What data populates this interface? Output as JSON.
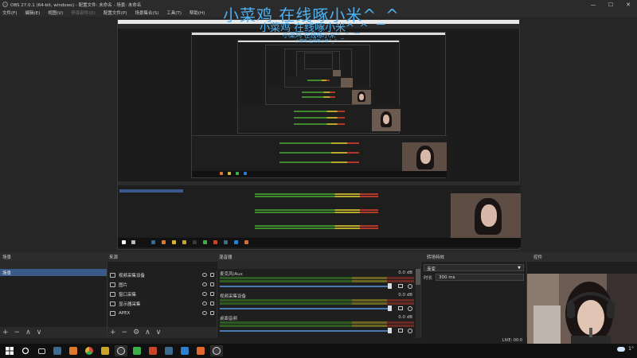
{
  "window": {
    "title": "OBS 27.0.1 (64-bit, windows) - 配置文件: 未命名 - 场景: 未命名",
    "minimize": "—",
    "maximize": "☐",
    "close": "✕"
  },
  "menu": [
    {
      "label": "文件(F)",
      "enabled": true
    },
    {
      "label": "编辑(E)",
      "enabled": true
    },
    {
      "label": "视图(V)",
      "enabled": true
    },
    {
      "label": "停靠部件(D)",
      "enabled": false
    },
    {
      "label": "配置文件(P)",
      "enabled": true
    },
    {
      "label": "场景集合(S)",
      "enabled": true
    },
    {
      "label": "工具(T)",
      "enabled": true
    },
    {
      "label": "帮助(H)",
      "enabled": true
    }
  ],
  "overlay": {
    "text": "小菜鸡 在线啄小米^_^",
    "color": "#4fb0f0"
  },
  "docks": {
    "scenes": {
      "title": "场景",
      "items": [
        "场景"
      ]
    },
    "sources": {
      "title": "来源",
      "items": [
        {
          "label": "视频采集设备",
          "icon": "camera-icon"
        },
        {
          "label": "图片",
          "icon": "image-icon"
        },
        {
          "label": "窗口采集",
          "icon": "window-icon"
        },
        {
          "label": "显示器采集",
          "icon": "monitor-icon"
        },
        {
          "label": "APEX",
          "icon": "game-icon"
        }
      ]
    },
    "mixer": {
      "title": "混音器",
      "channels": [
        {
          "name": "麦克风/Aux",
          "db": "0.0 dB"
        },
        {
          "name": "视频采集设备",
          "db": "0.0 dB"
        },
        {
          "name": "桌面音频",
          "db": "0.0 dB"
        }
      ]
    },
    "transitions": {
      "title": "转场特效",
      "selected": "渐变",
      "duration_label": "时长",
      "duration_value": "300 ms"
    },
    "controls": {
      "title": "控件"
    }
  },
  "status": {
    "live": "LIVE: 00:0"
  },
  "taskbar": {
    "items": [
      {
        "name": "start-icon",
        "color": "#ffffff"
      },
      {
        "name": "search-icon",
        "color": "#ffffff"
      },
      {
        "name": "task-view-icon",
        "color": "#cccccc"
      },
      {
        "name": "steam-icon",
        "color": "#3d6b8e"
      },
      {
        "name": "app-orange-icon",
        "color": "#e0782a"
      },
      {
        "name": "chrome-icon",
        "color": "#d8b530"
      },
      {
        "name": "app-yellow-icon",
        "color": "#c9a32a"
      },
      {
        "name": "obs-icon",
        "color": "#3a3a3a"
      },
      {
        "name": "app-green-icon",
        "color": "#3bb04a"
      },
      {
        "name": "app-red-icon",
        "color": "#c9452a"
      },
      {
        "name": "steam2-icon",
        "color": "#3d6b8e"
      },
      {
        "name": "app-blue-icon",
        "color": "#2a7fd0"
      },
      {
        "name": "app-orange2-icon",
        "color": "#e06a2a"
      },
      {
        "name": "obs2-icon",
        "color": "#3a3a3a"
      }
    ],
    "temperature": "1°"
  }
}
